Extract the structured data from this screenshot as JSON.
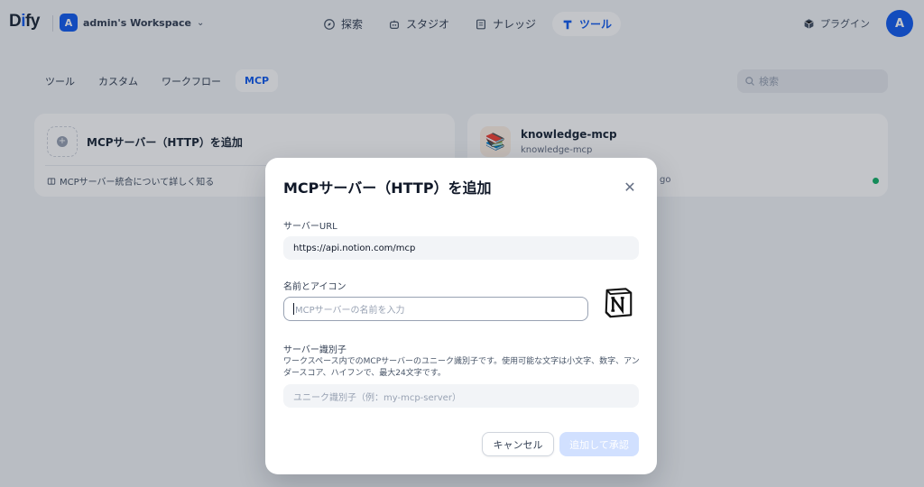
{
  "app": {
    "logo_main": "D",
    "logo_accent": "i",
    "logo_rest": "fy"
  },
  "workspace": {
    "badge": "A",
    "name": "admin's Workspace"
  },
  "nav": {
    "items": [
      {
        "label": "探索",
        "icon": "compass-icon"
      },
      {
        "label": "スタジオ",
        "icon": "robot-icon"
      },
      {
        "label": "ナレッジ",
        "icon": "book-icon"
      },
      {
        "label": "ツール",
        "icon": "tool-icon",
        "active": true
      }
    ],
    "plugin_label": "プラグイン",
    "avatar": "A"
  },
  "subtabs": [
    "ツール",
    "カスタム",
    "ワークフロー",
    "MCP"
  ],
  "search": {
    "placeholder": "検索"
  },
  "cards": {
    "add": {
      "title": "MCPサーバー（HTTP）を追加",
      "learn_more": "MCPサーバー統合について詳しく知る"
    },
    "server": {
      "title": "knowledge-mcp",
      "subtitle": "knowledge-mcp",
      "meta_tail": "go",
      "status_color": "#17b26a"
    }
  },
  "modal": {
    "title": "MCPサーバー（HTTP）を追加",
    "url_label": "サーバーURL",
    "url_value": "https://api.notion.com/mcp",
    "name_label": "名前とアイコン",
    "name_placeholder": "MCPサーバーの名前を入力",
    "id_label": "サーバー識別子",
    "id_description": "ワークスペース内でのMCPサーバーのユニーク識別子です。使用可能な文字は小文字、数字、アンダースコア、ハイフンで、最大24文字です。",
    "id_placeholder": "ユニーク識別子（例：my-mcp-server）",
    "cancel_label": "キャンセル",
    "submit_label": "追加して承認",
    "icon": "notion-logo-icon"
  }
}
